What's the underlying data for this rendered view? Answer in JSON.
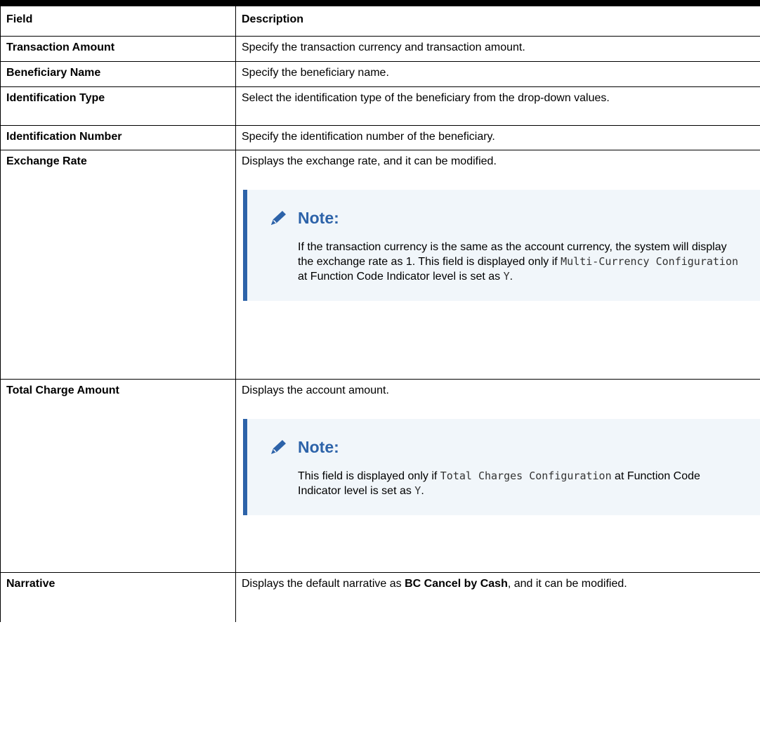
{
  "table": {
    "header": {
      "field": "Field",
      "description": "Description"
    },
    "rows": [
      {
        "field": "Transaction Amount",
        "description": "Specify the transaction currency and transaction amount."
      },
      {
        "field": "Beneficiary Name",
        "description": "Specify the beneficiary name."
      },
      {
        "field": "Identification Type",
        "description": "Select the identification type of the beneficiary from the drop-down values."
      },
      {
        "field": "Identification Number",
        "description": "Specify the identification number of the beneficiary."
      },
      {
        "field": "Exchange Rate",
        "description": "Displays the exchange rate, and it can be modified.",
        "note": {
          "title": "Note:",
          "text1": "If the transaction currency is the same as the account currency, the system will display the exchange rate as 1. This field is displayed only if ",
          "code1": "Multi-Currency Configuration",
          "text2": " at Function Code Indicator level is set as ",
          "code2": "Y",
          "text3": "."
        }
      },
      {
        "field": "Total Charge Amount",
        "description": "Displays the account amount.",
        "note": {
          "title": "Note:",
          "text1": "This field is displayed only if ",
          "code1": "Total Charges Configuration",
          "text2": " at Function Code Indicator level is set as ",
          "code2": "Y",
          "text3": "."
        }
      },
      {
        "field": "Narrative",
        "description_pre": "Displays the default narrative as ",
        "description_bold": "BC Cancel by Cash",
        "description_post": ", and it can be modified."
      }
    ]
  },
  "colors": {
    "note_accent": "#2d63a9",
    "note_background": "#f1f6fa"
  },
  "icons": {
    "note_icon": "pencil-icon"
  }
}
